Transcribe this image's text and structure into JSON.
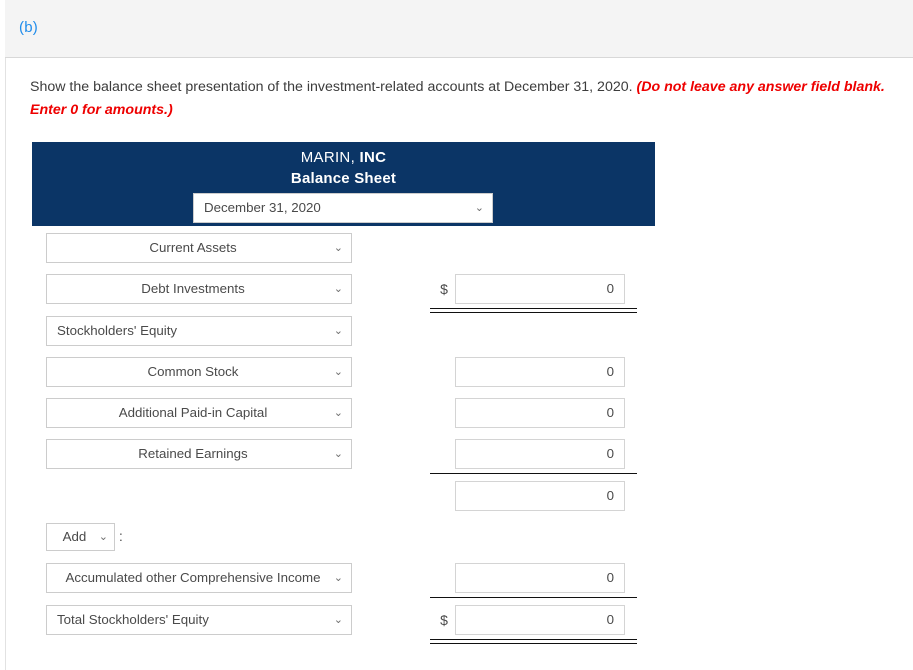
{
  "part": {
    "label": "(b)"
  },
  "instructions": {
    "text_main": "Show the balance sheet presentation of the investment-related accounts at December 31, 2020. ",
    "text_emphasis": "(Do not leave any answer field blank. Enter 0 for amounts.)"
  },
  "statement": {
    "company_normal": "MARIN, ",
    "company_strong": "INC",
    "subtitle": "Balance Sheet",
    "date_select": {
      "value": "December 31, 2020",
      "caret": "⌄"
    }
  },
  "rows": [
    {
      "account": "Current Assets",
      "align": "center",
      "amount": null,
      "dollar": "",
      "rule": "none"
    },
    {
      "account": "Debt Investments",
      "align": "center",
      "amount": "0",
      "dollar": "$",
      "rule": "double"
    },
    {
      "account": "Stockholders' Equity",
      "align": "left",
      "amount": null,
      "dollar": "",
      "rule": "none"
    },
    {
      "account": "Common Stock",
      "align": "center",
      "amount": "0",
      "dollar": "",
      "rule": "none"
    },
    {
      "account": "Additional Paid-in Capital",
      "align": "center",
      "amount": "0",
      "dollar": "",
      "rule": "none"
    },
    {
      "account": "Retained Earnings",
      "align": "center",
      "amount": "0",
      "dollar": "",
      "rule": "single"
    },
    {
      "account": null,
      "align": "center",
      "amount": "0",
      "dollar": "",
      "rule": "none"
    },
    {
      "account": "Accumulated other Comprehensive Income",
      "align": "center",
      "amount": "0",
      "dollar": "",
      "rule": "single"
    },
    {
      "account": "Total Stockholders' Equity",
      "align": "left",
      "amount": "0",
      "dollar": "$",
      "rule": "double"
    }
  ],
  "add_group": {
    "value": "Add",
    "caret": "⌄",
    "colon": ":"
  },
  "colors": {
    "header_navy": "#0b3566",
    "link_blue": "#1f8ceb",
    "emphasis_red": "#ee0000"
  }
}
